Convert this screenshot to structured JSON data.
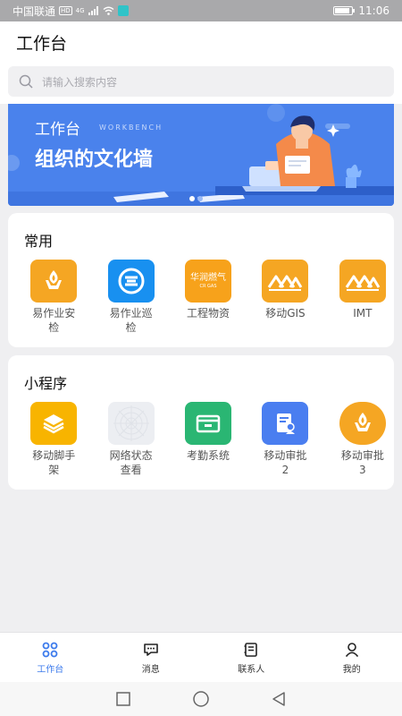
{
  "statusbar": {
    "carrier": "中国联通",
    "hd": "HD",
    "net": "4G",
    "time": "11:06",
    "battery_level": 0.85
  },
  "header": {
    "title": "工作台"
  },
  "search": {
    "placeholder": "请输入搜索内容"
  },
  "banner": {
    "title": "工作台",
    "subtitle_en": "WORKBENCH",
    "headline": "组织的文化墙",
    "active_dot": 0
  },
  "common": {
    "title": "常用",
    "apps": [
      {
        "label": "易作业安检",
        "icon": "flame-hand-icon",
        "color": "#f5a623"
      },
      {
        "label": "易作业巡检",
        "icon": "s-logo-icon",
        "color": "#1890f0"
      },
      {
        "label": "工程物资",
        "icon": "gas-logo-icon",
        "color": "#f7a21b",
        "logo_text": "华润燃气",
        "logo_sub": "CR GAS"
      },
      {
        "label": "移动GIS",
        "icon": "mountain-icon",
        "color": "#f5a623"
      },
      {
        "label": "IMT",
        "icon": "mountain-icon",
        "color": "#f5a623"
      }
    ]
  },
  "mini": {
    "title": "小程序",
    "apps": [
      {
        "label": "移动脚手架",
        "icon": "layers-icon",
        "color": "#f8b400"
      },
      {
        "label": "网络状态查看",
        "icon": "web-icon",
        "color": "#eceef2"
      },
      {
        "label": "考勤系统",
        "icon": "window-icon",
        "color": "#2ab673"
      },
      {
        "label": "移动审批2",
        "icon": "approval-doc-icon",
        "color": "#4a7ef0"
      },
      {
        "label": "移动审批3",
        "icon": "flame-hand-icon",
        "color": "#f5a623"
      }
    ]
  },
  "tabbar": [
    {
      "label": "工作台",
      "icon": "grid-icon"
    },
    {
      "label": "消息",
      "icon": "chat-icon"
    },
    {
      "label": "联系人",
      "icon": "contacts-icon"
    },
    {
      "label": "我的",
      "icon": "user-icon"
    }
  ],
  "colors": {
    "accent": "#3d7bec",
    "banner": "#4a82ec"
  }
}
